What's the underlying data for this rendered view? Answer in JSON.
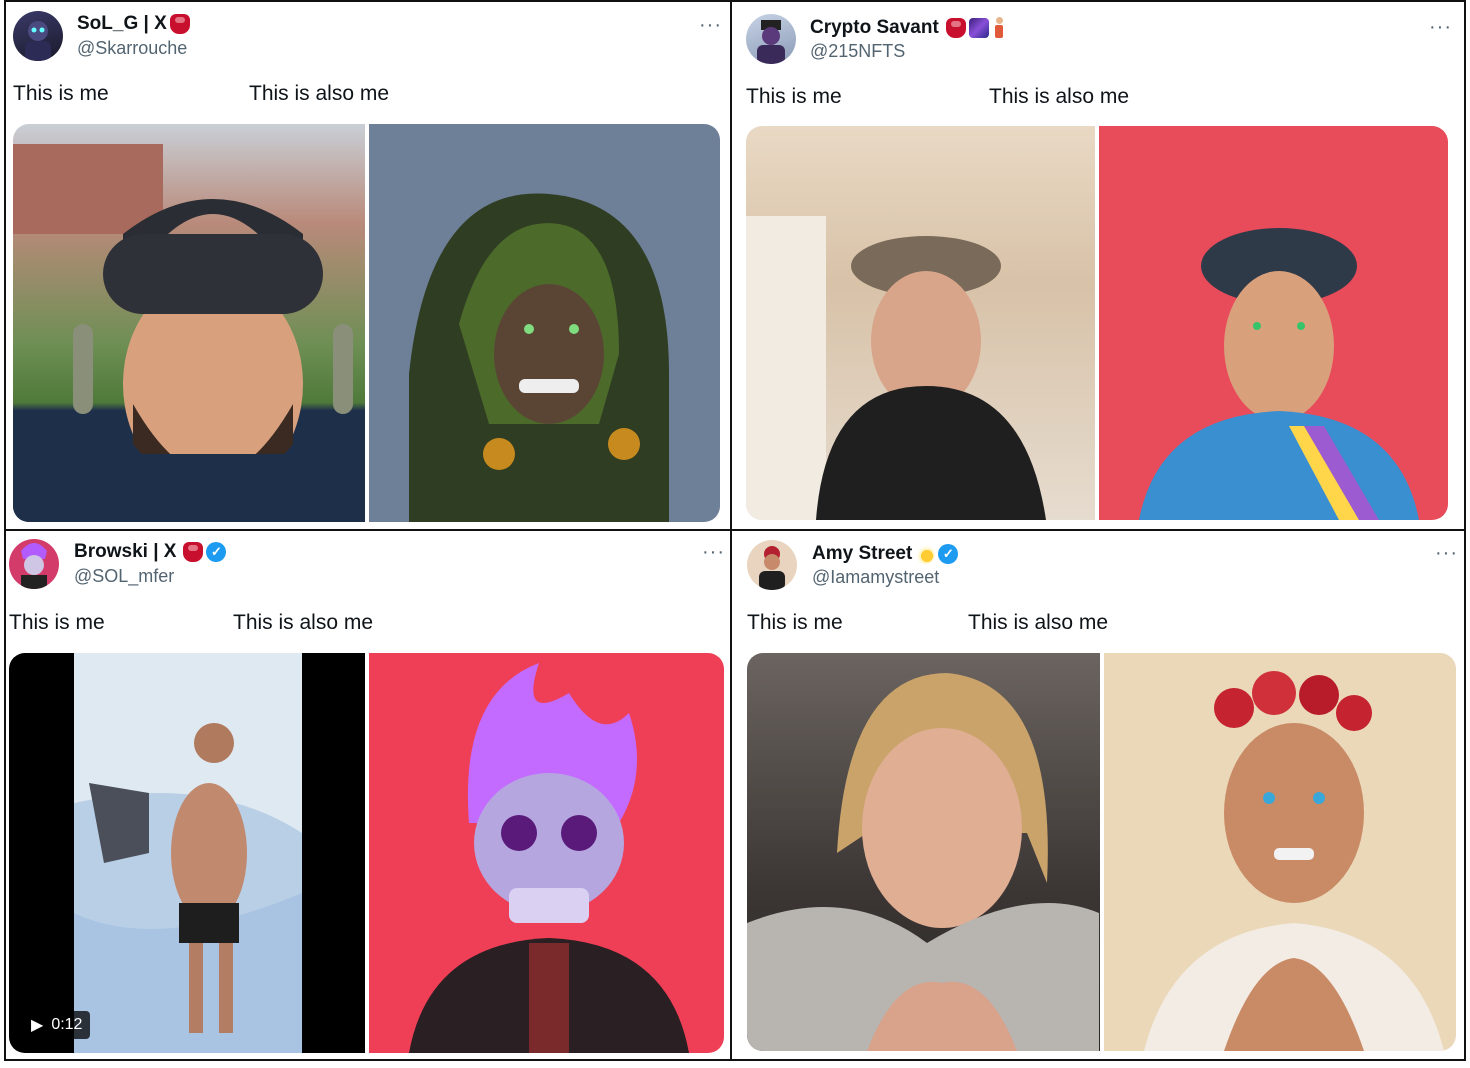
{
  "tweets": [
    {
      "name": "SoL_G | X",
      "handle": "@Skarrouche",
      "caption_left": "This is me",
      "caption_right": "This is also me",
      "more": "···",
      "name_emojis": [
        "boxing-glove-emoji"
      ],
      "verified": false
    },
    {
      "name": "Crypto Savant",
      "handle": "@215NFTS",
      "caption_left": "This is me",
      "caption_right": "This is also me",
      "more": "···",
      "name_emojis": [
        "boxing-glove-emoji",
        "galaxy-emoji",
        "golfer-emoji"
      ],
      "verified": false
    },
    {
      "name": "Browski | X",
      "handle": "@SOL_mfer",
      "caption_left": "This is me",
      "caption_right": "This is also me",
      "more": "···",
      "name_emojis": [
        "boxing-glove-emoji"
      ],
      "verified": true,
      "video_duration": "0:12"
    },
    {
      "name": "Amy Street",
      "handle": "@Iamamystreet",
      "caption_left": "This is me",
      "caption_right": "This is also me",
      "more": "···",
      "name_emojis": [
        "dizzy-emoji"
      ],
      "verified": true
    }
  ],
  "colors": {
    "text": "#0f1419",
    "secondary": "#536471",
    "verified_blue": "#1d9bf0",
    "border": "#111111"
  },
  "icons": {
    "more": "more-options-icon",
    "verified": "verified-badge-icon",
    "play": "play-icon"
  }
}
